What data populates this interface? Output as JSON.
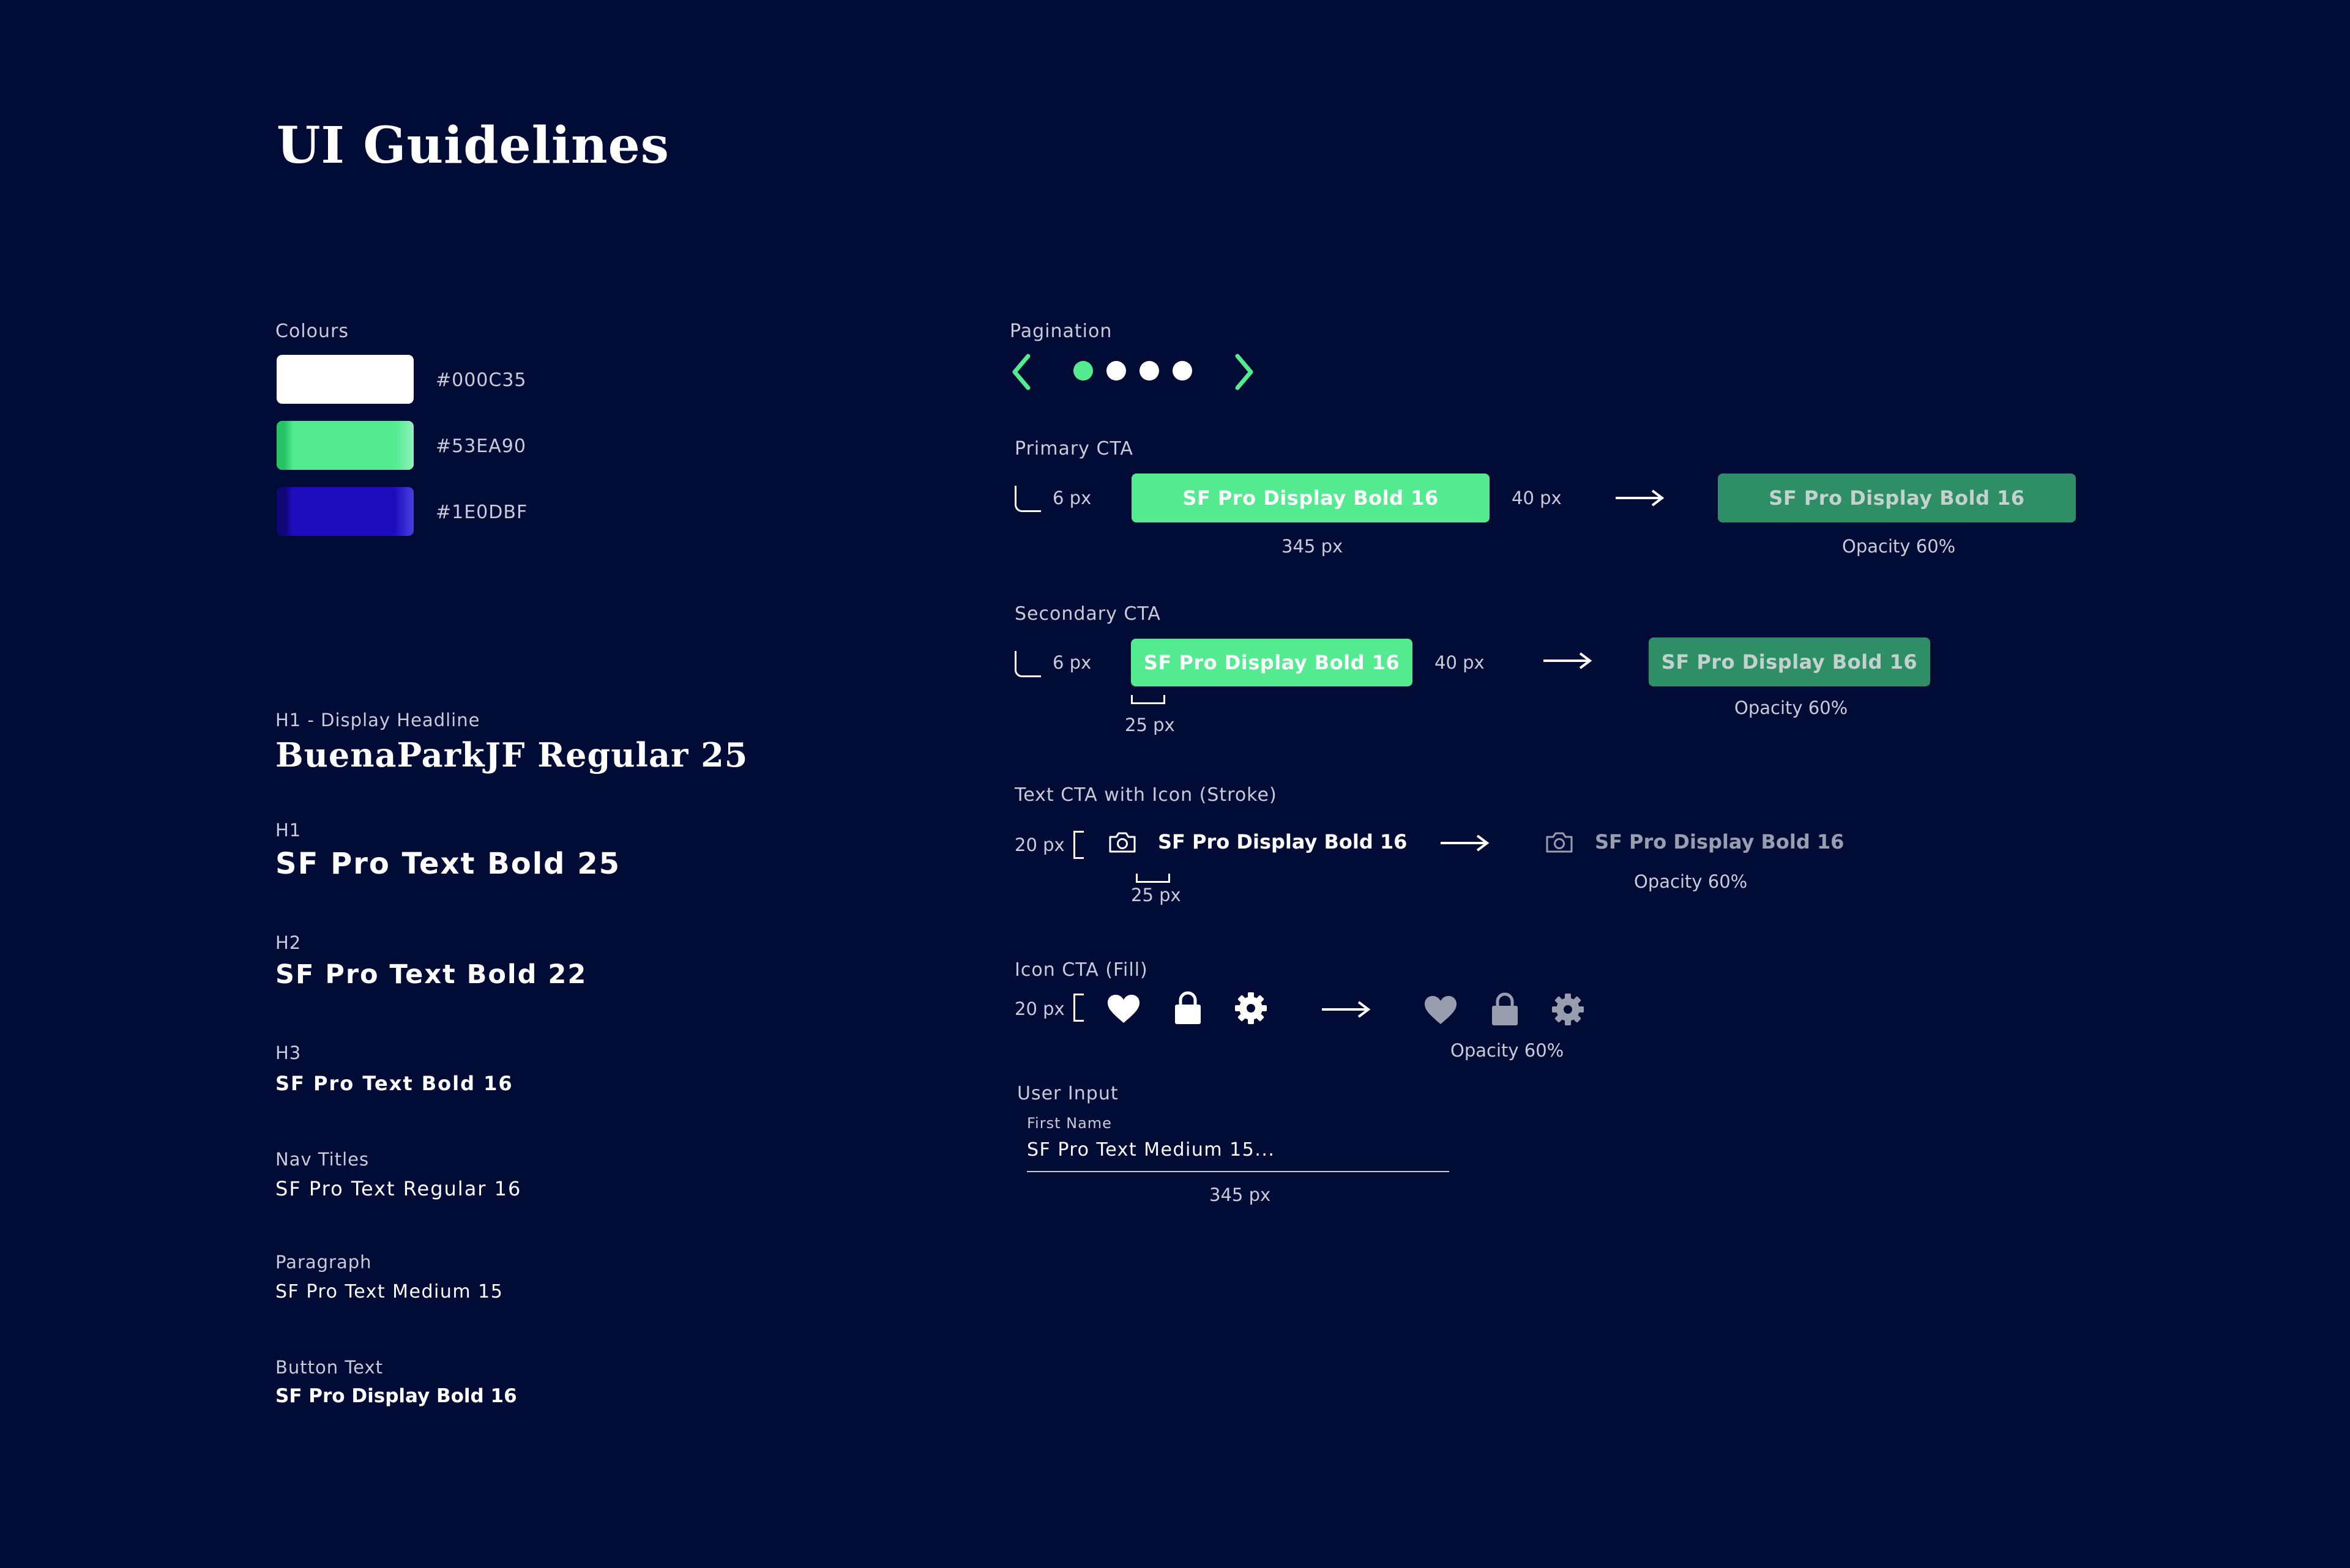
{
  "title": "UI Guidelines",
  "colours": {
    "heading": "Colours",
    "items": [
      {
        "hex": "#000C35",
        "color": "#ffffff"
      },
      {
        "hex": "#53EA90",
        "color": "#53EA90"
      },
      {
        "hex": "#1E0DBF",
        "color": "#1E0DBF"
      }
    ]
  },
  "typography": [
    {
      "label": "H1 - Display Headline",
      "sample": "BuenaParkJF Regular 25"
    },
    {
      "label": "H1",
      "sample": "SF Pro Text Bold 25"
    },
    {
      "label": "H2",
      "sample": "SF Pro Text Bold 22"
    },
    {
      "label": "H3",
      "sample": "SF Pro Text Bold 16"
    },
    {
      "label": "Nav Titles",
      "sample": "SF Pro Text Regular 16"
    },
    {
      "label": "Paragraph",
      "sample": "SF Pro Text Medium 15"
    },
    {
      "label": "Button Text",
      "sample": "SF Pro Display Bold 16"
    }
  ],
  "pagination": {
    "heading": "Pagination",
    "prev_icon": "chevron-left-icon",
    "next_icon": "chevron-right-icon",
    "active_index": 0,
    "dot_count": 4
  },
  "primary_cta": {
    "heading": "Primary CTA",
    "radius": "6 px",
    "label": "SF Pro Display Bold 16",
    "width": "345 px",
    "height": "40 px",
    "disabled_label": "SF Pro Display Bold 16",
    "opacity_note": "Opacity 60%"
  },
  "secondary_cta": {
    "heading": "Secondary CTA",
    "radius": "6 px",
    "label": "SF Pro Display Bold 16",
    "height": "40 px",
    "padding": "25 px",
    "disabled_label": "SF Pro Display Bold 16",
    "opacity_note": "Opacity 60%"
  },
  "text_cta": {
    "heading": "Text CTA with Icon (Stroke)",
    "size": "20 px",
    "label": "SF Pro Display Bold 16",
    "gap": "25 px",
    "disabled_label": "SF Pro Display Bold 16",
    "opacity_note": "Opacity 60%",
    "icon": "camera-icon"
  },
  "icon_cta": {
    "heading": "Icon CTA (Fill)",
    "size": "20 px",
    "icons": [
      "heart-icon",
      "lock-icon",
      "gear-icon"
    ],
    "opacity_note": "Opacity 60%"
  },
  "user_input": {
    "heading": "User Input",
    "field_label": "First Name",
    "value": "SF Pro Text Medium 15...",
    "width": "345 px"
  },
  "accent": "#53EA90",
  "accent_faded": "#2E8F66"
}
